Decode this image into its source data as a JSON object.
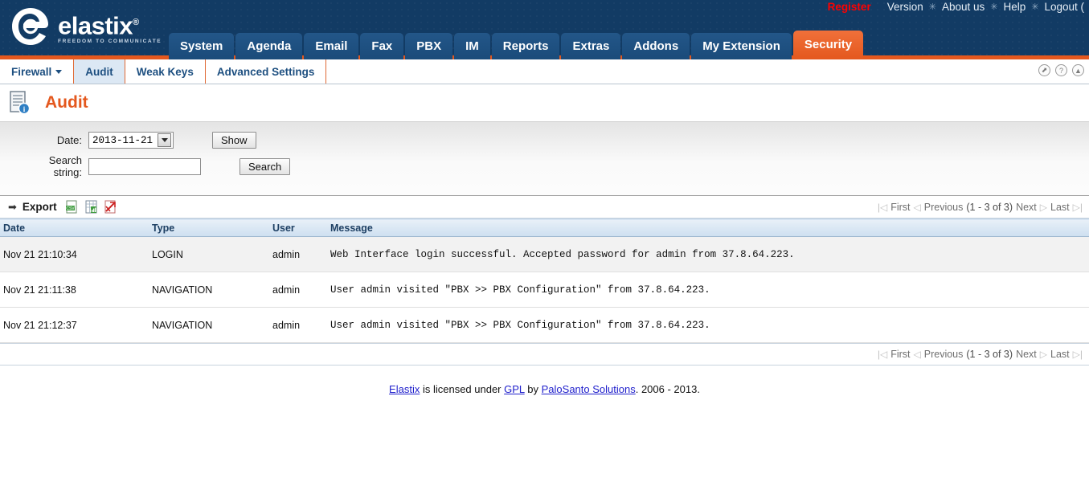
{
  "header": {
    "brand": {
      "name": "elastix",
      "registered_mark": "®",
      "tagline": "FREEDOM TO COMMUNICATE",
      "logo_icon": "elastix-logo-icon"
    },
    "utility_links": [
      {
        "label": "Register",
        "style": "register"
      },
      {
        "label": "Version"
      },
      {
        "label": "About us"
      },
      {
        "label": "Help"
      },
      {
        "label": "Logout ("
      }
    ],
    "separator": "✳",
    "tabs": [
      {
        "label": "System",
        "active": false
      },
      {
        "label": "Agenda",
        "active": false
      },
      {
        "label": "Email",
        "active": false
      },
      {
        "label": "Fax",
        "active": false
      },
      {
        "label": "PBX",
        "active": false
      },
      {
        "label": "IM",
        "active": false
      },
      {
        "label": "Reports",
        "active": false
      },
      {
        "label": "Extras",
        "active": false
      },
      {
        "label": "Addons",
        "active": false
      },
      {
        "label": "My Extension",
        "active": false
      },
      {
        "label": "Security",
        "active": true
      }
    ],
    "accent_color": "#e4581e",
    "background_color": "#123b64"
  },
  "subnav": {
    "items": [
      {
        "label": "Firewall",
        "has_dropdown": true,
        "active": false
      },
      {
        "label": "Audit",
        "has_dropdown": false,
        "active": true
      },
      {
        "label": "Weak Keys",
        "has_dropdown": false,
        "active": false
      },
      {
        "label": "Advanced Settings",
        "has_dropdown": false,
        "active": false
      }
    ],
    "icons": [
      {
        "name": "popup-window-icon",
        "glyph": "⬈"
      },
      {
        "name": "help-icon",
        "glyph": "?"
      },
      {
        "name": "scroll-top-icon",
        "glyph": "▲"
      }
    ]
  },
  "page": {
    "title": "Audit",
    "title_icon": "document-info-icon",
    "title_color": "#e4581e"
  },
  "filters": {
    "date_label": "Date:",
    "date_value": "2013-11-21",
    "show_button": "Show",
    "search_label_line1": "Search",
    "search_label_line2": "string:",
    "search_value": "",
    "search_placeholder": "",
    "search_button": "Search"
  },
  "toolbar": {
    "export_label": "Export",
    "export_arrow": "➡",
    "export_icons": [
      {
        "name": "export-csv-icon",
        "label": "CSV"
      },
      {
        "name": "export-excel-icon",
        "label": "XLS"
      },
      {
        "name": "export-pdf-icon",
        "label": "PDF"
      }
    ]
  },
  "pagination": {
    "first": "First",
    "previous": "Previous",
    "range": "(1 - 3 of 3)",
    "next": "Next",
    "last": "Last",
    "first_glyph": "|◁",
    "previous_glyph": "◁",
    "next_glyph": "▷",
    "last_glyph": "▷|"
  },
  "table": {
    "columns": [
      "Date",
      "Type",
      "User",
      "Message"
    ],
    "rows": [
      {
        "date": "Nov 21 21:10:34",
        "type": "LOGIN",
        "user": "admin",
        "message": "Web Interface login successful. Accepted password for admin from 37.8.64.223."
      },
      {
        "date": "Nov 21 21:11:38",
        "type": "NAVIGATION",
        "user": "admin",
        "message": "User admin visited \"PBX >> PBX Configuration\" from 37.8.64.223."
      },
      {
        "date": "Nov 21 21:12:37",
        "type": "NAVIGATION",
        "user": "admin",
        "message": "User admin visited \"PBX >> PBX Configuration\" from 37.8.64.223."
      }
    ]
  },
  "footer": {
    "link_elastix": "Elastix",
    "text_1": " is licensed under ",
    "link_gpl": "GPL",
    "text_2": " by ",
    "link_palosanto": "PaloSanto Solutions",
    "text_3": ". 2006 - 2013."
  }
}
